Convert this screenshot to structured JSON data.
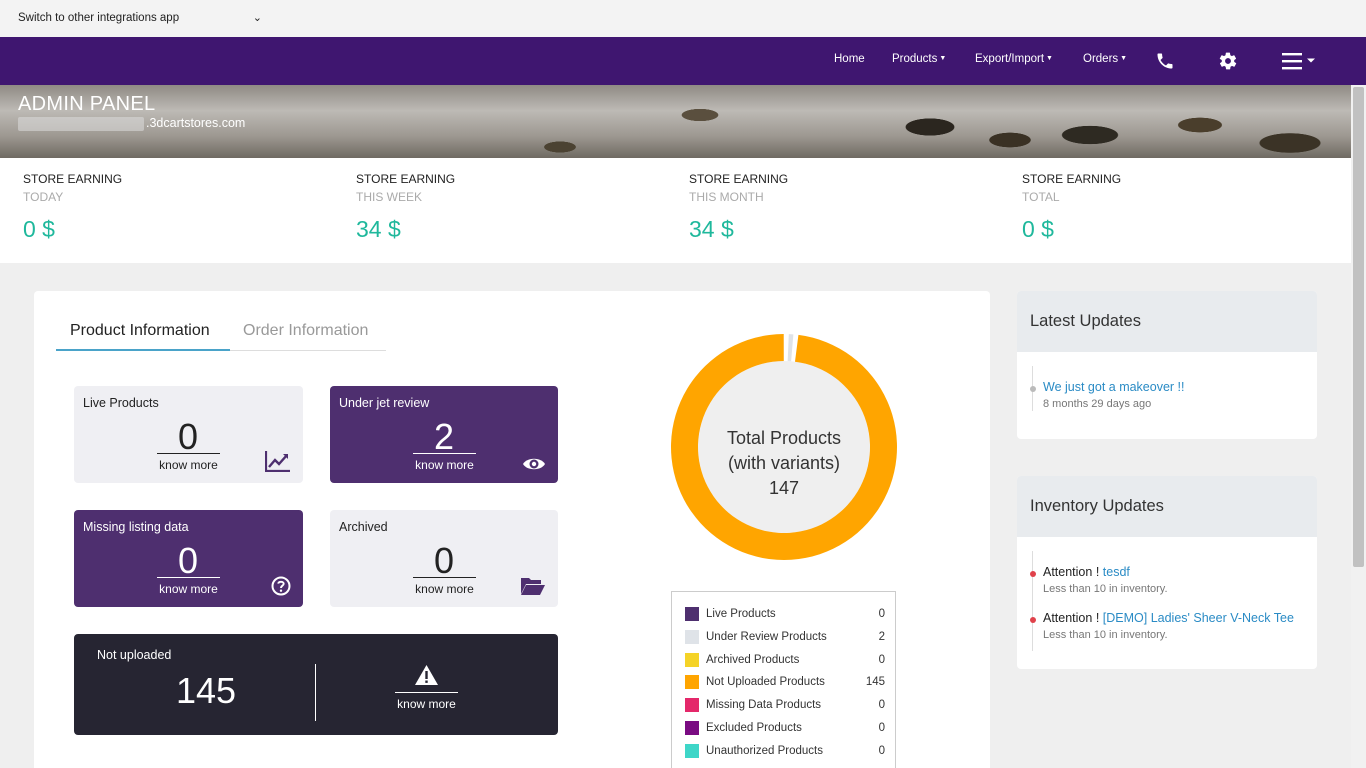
{
  "switcher": {
    "label": "Switch to other integrations app",
    "icon": "chevron-down-icon"
  },
  "nav": {
    "home": "Home",
    "products": "Products",
    "export_import": "Export/Import",
    "orders": "Orders",
    "icons": [
      "phone-icon",
      "gear-icon",
      "hamburger-menu-icon"
    ]
  },
  "hero": {
    "title": "ADMIN PANEL",
    "store_domain": ".3dcartstores.com"
  },
  "earnings": [
    {
      "label": "STORE EARNING",
      "period": "TODAY",
      "value": "0 $"
    },
    {
      "label": "STORE EARNING",
      "period": "THIS WEEK",
      "value": "34 $"
    },
    {
      "label": "STORE EARNING",
      "period": "THIS MONTH",
      "value": "34 $"
    },
    {
      "label": "STORE EARNING",
      "period": "TOTAL",
      "value": "0 $"
    }
  ],
  "tabs": {
    "product": "Product Information",
    "order": "Order Information"
  },
  "tiles": {
    "live": {
      "label": "Live Products",
      "count": "0",
      "more": "know more",
      "icon": "line-chart-icon"
    },
    "review": {
      "label": "Under jet review",
      "count": "2",
      "more": "know more",
      "icon": "eye-icon"
    },
    "missing": {
      "label": "Missing listing data",
      "count": "0",
      "more": "know more",
      "icon": "question-circle-icon"
    },
    "archived": {
      "label": "Archived",
      "count": "0",
      "more": "know more",
      "icon": "folder-open-icon"
    },
    "not_uploaded": {
      "label": "Not uploaded",
      "count": "145",
      "more": "know more",
      "icon": "warning-icon"
    }
  },
  "donut": {
    "line1": "Total Products",
    "line2": "(with variants)",
    "total": "147"
  },
  "chart_data": {
    "type": "pie",
    "title": "",
    "slices": [
      {
        "name": "Live Products",
        "value": 0,
        "color": "#4e2f6f"
      },
      {
        "name": "Under Review Products",
        "value": 2,
        "color": "#dfe3e8"
      },
      {
        "name": "Archived Products",
        "value": 0,
        "color": "#f5d327"
      },
      {
        "name": "Not Uploaded Products",
        "value": 145,
        "color": "#ffa500"
      },
      {
        "name": "Missing Data Products",
        "value": 0,
        "color": "#e4286a"
      },
      {
        "name": "Excluded Products",
        "value": 0,
        "color": "#7a0b82"
      },
      {
        "name": "Unauthorized Products",
        "value": 0,
        "color": "#3ed6c8"
      }
    ]
  },
  "latest_updates": {
    "title": "Latest Updates",
    "items": [
      {
        "text": "We just got a makeover !!",
        "time": "8 months 29 days ago"
      }
    ]
  },
  "inventory_updates": {
    "title": "Inventory Updates",
    "items": [
      {
        "prefix": "Attention !",
        "product": "tesdf",
        "note": "Less than 10 in inventory."
      },
      {
        "prefix": "Attention !",
        "product": "[DEMO] Ladies' Sheer V-Neck Tee",
        "note": "Less than 10 in inventory."
      }
    ]
  },
  "colors": {
    "nav": "#3f1670",
    "accent_green": "#1fb89c",
    "tile_purple": "#4e2f6f",
    "tile_dark": "#262532",
    "link": "#2a8bc5"
  }
}
